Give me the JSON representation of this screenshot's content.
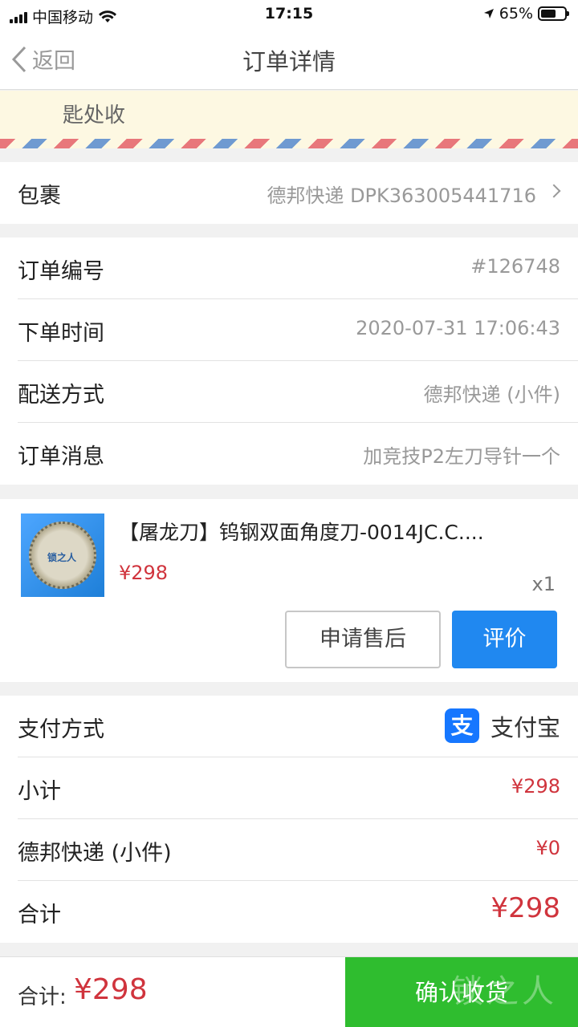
{
  "status_bar": {
    "carrier": "中国移动",
    "time": "17:15",
    "battery": "65%"
  },
  "nav": {
    "back_label": "返回",
    "title": "订单详情"
  },
  "notice": {
    "text": "匙处收"
  },
  "package": {
    "label": "包裹",
    "value": "德邦快递 DPK363005441716"
  },
  "order_info": [
    {
      "label": "订单编号",
      "value": "#126748"
    },
    {
      "label": "下单时间",
      "value": "2020-07-31 17:06:43"
    },
    {
      "label": "配送方式",
      "value": "德邦快递 (小件)"
    },
    {
      "label": "订单消息",
      "value": "加竞技P2左刀导针一个"
    }
  ],
  "product": {
    "title": "【屠龙刀】钨钢双面角度刀-0014JC.C....",
    "price": "¥298",
    "qty": "x1",
    "thumb_text": "锁之人",
    "after_sale_label": "申请售后",
    "review_label": "评价"
  },
  "payment": {
    "label": "支付方式",
    "method": "支付宝",
    "logo_glyph": "支",
    "subtotal_label": "小计",
    "subtotal_value": "¥298",
    "shipping_label": "德邦快递 (小件)",
    "shipping_value": "¥0",
    "total_label": "合计",
    "total_value": "¥298"
  },
  "bottom_bar": {
    "total_label": "合计:",
    "total_value": "¥298",
    "confirm_label": "确认收货",
    "watermark": "锁之人"
  },
  "colors": {
    "accent_blue": "#2088f0",
    "price_red": "#d0343d",
    "confirm_green": "#2fbd2f",
    "notice_bg": "#fdf8e2"
  }
}
